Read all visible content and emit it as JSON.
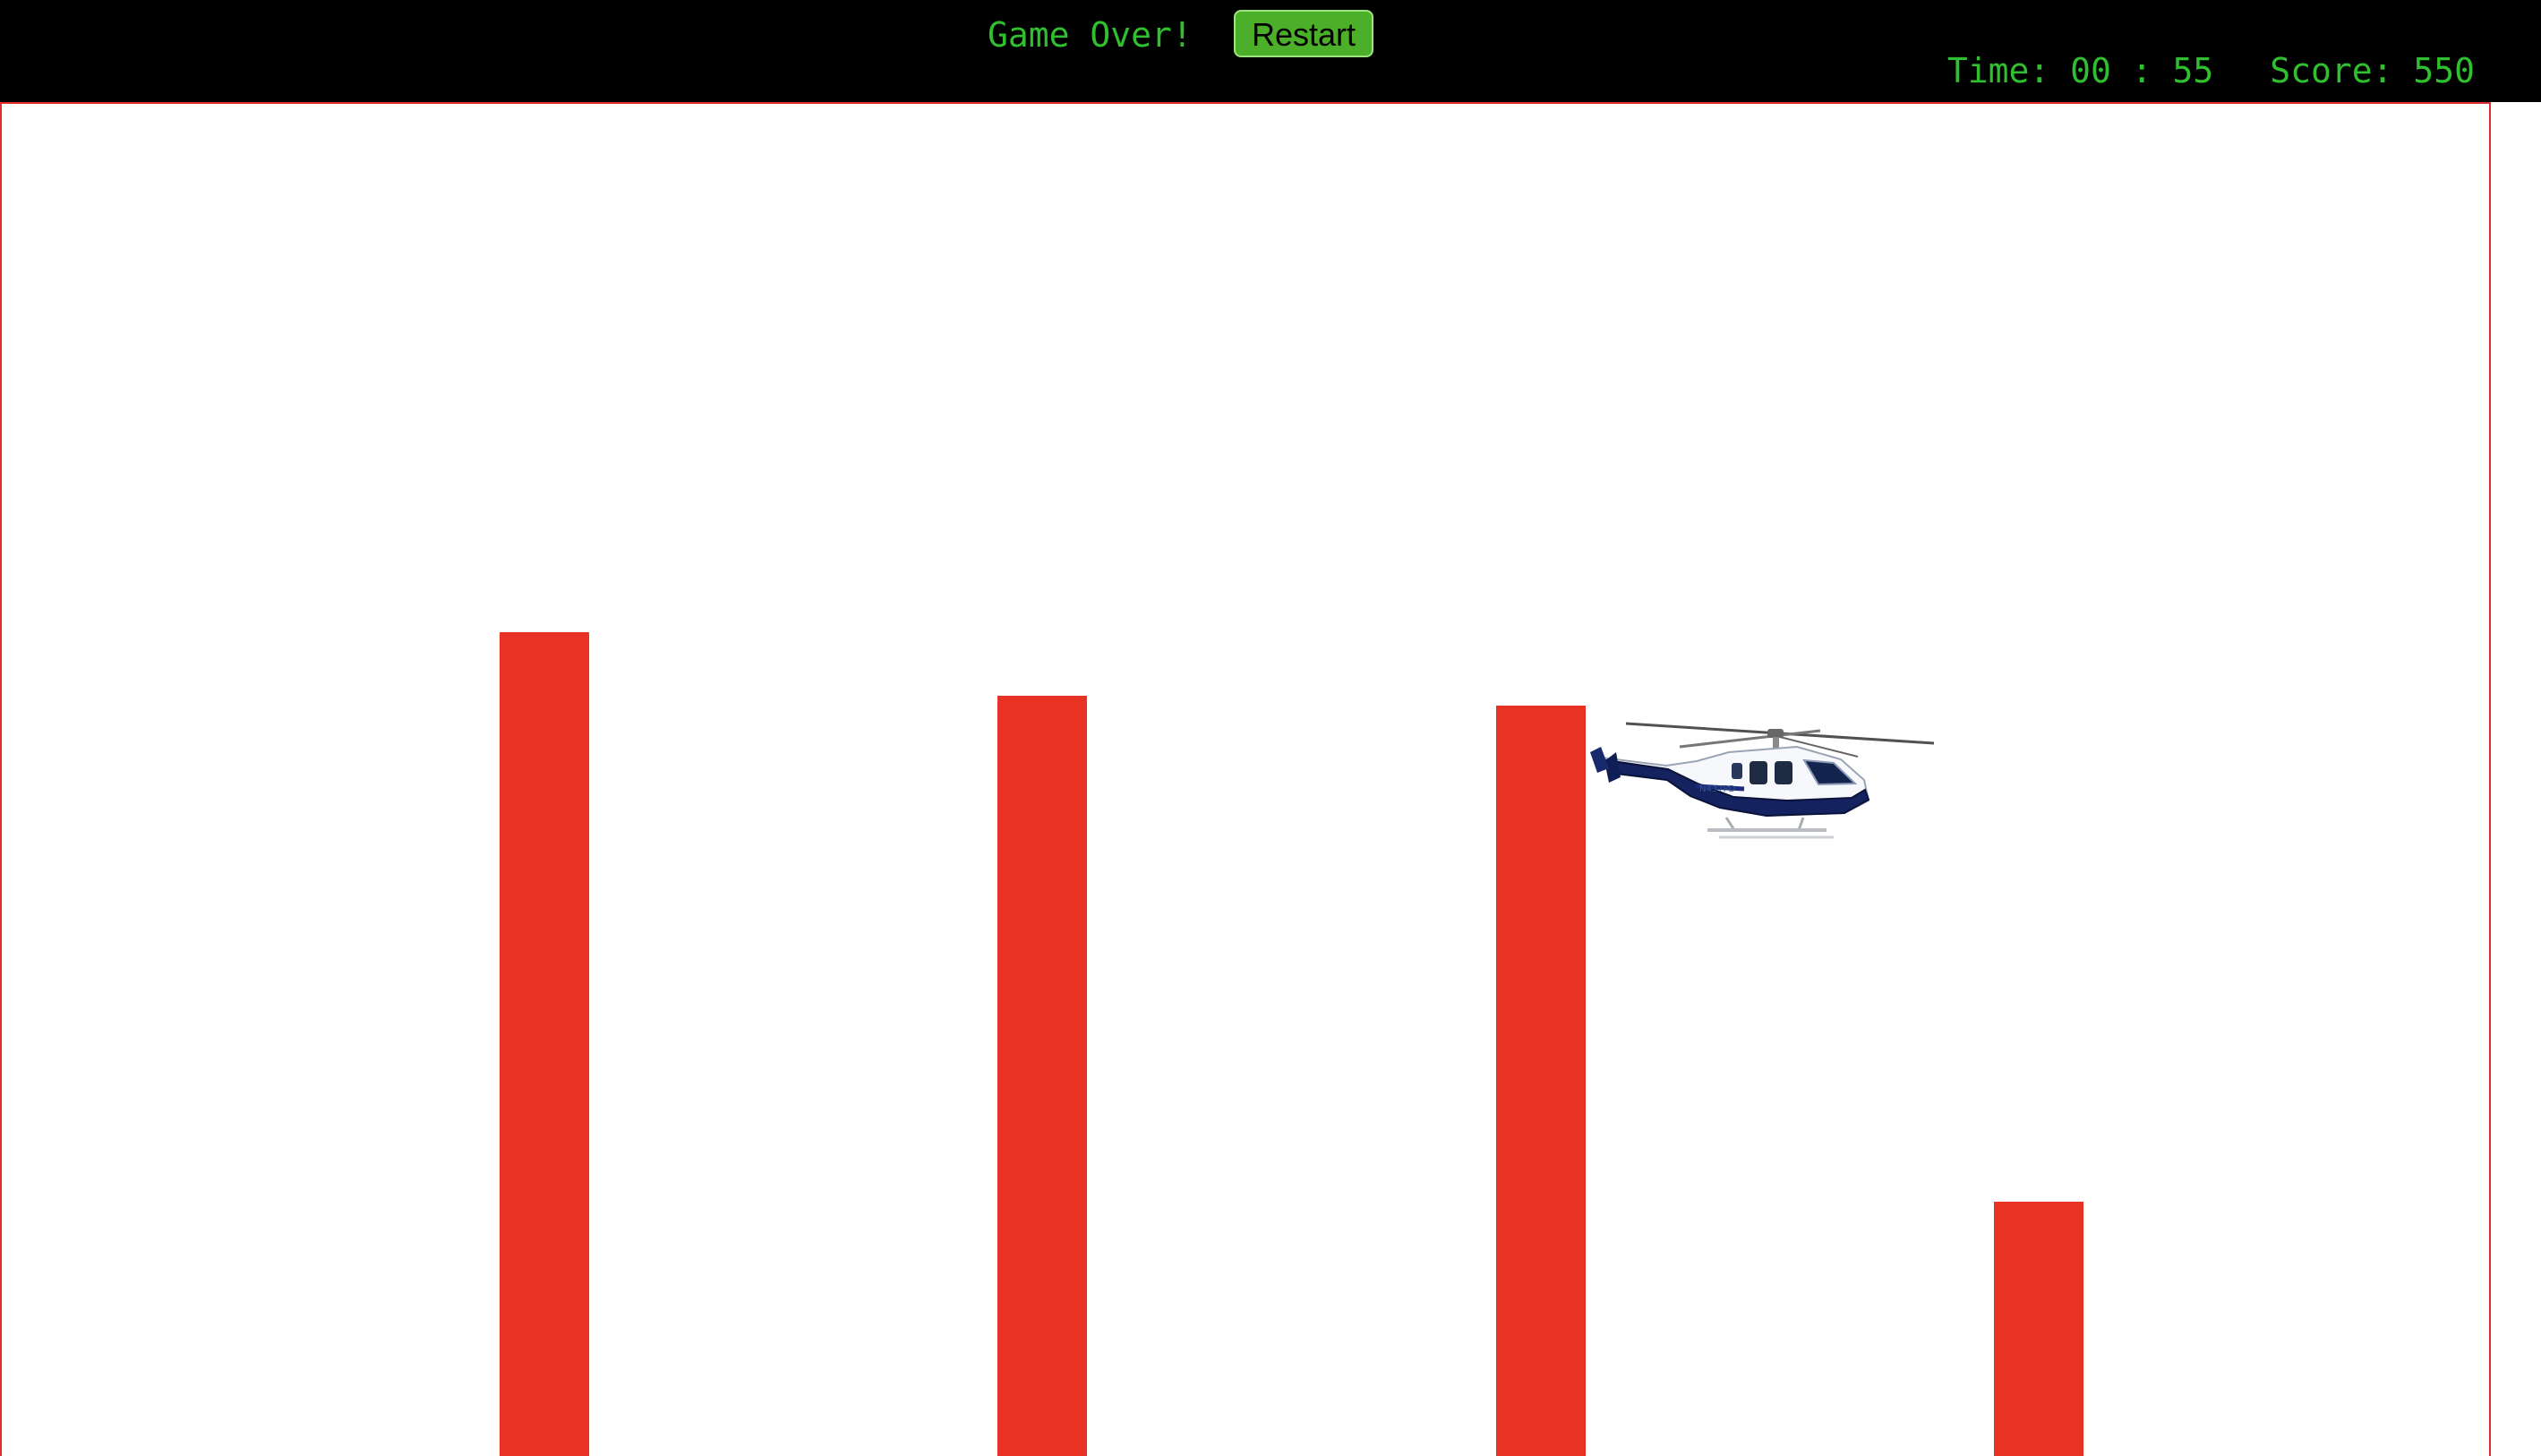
{
  "header": {
    "status_text": "Game Over!",
    "restart_label": "Restart",
    "time_label": "Time:",
    "time_value": "00 : 55",
    "score_label": "Score:",
    "score_value": "550"
  },
  "game": {
    "obstacle_count": 4,
    "player_icon": "helicopter-icon",
    "colors": {
      "topbar_background": "#000000",
      "status_text": "#2fbf2f",
      "button_background": "#4caf2a",
      "obstacle": "#e83223",
      "game_border": "#e12d2d",
      "game_background": "#ffffff"
    }
  }
}
